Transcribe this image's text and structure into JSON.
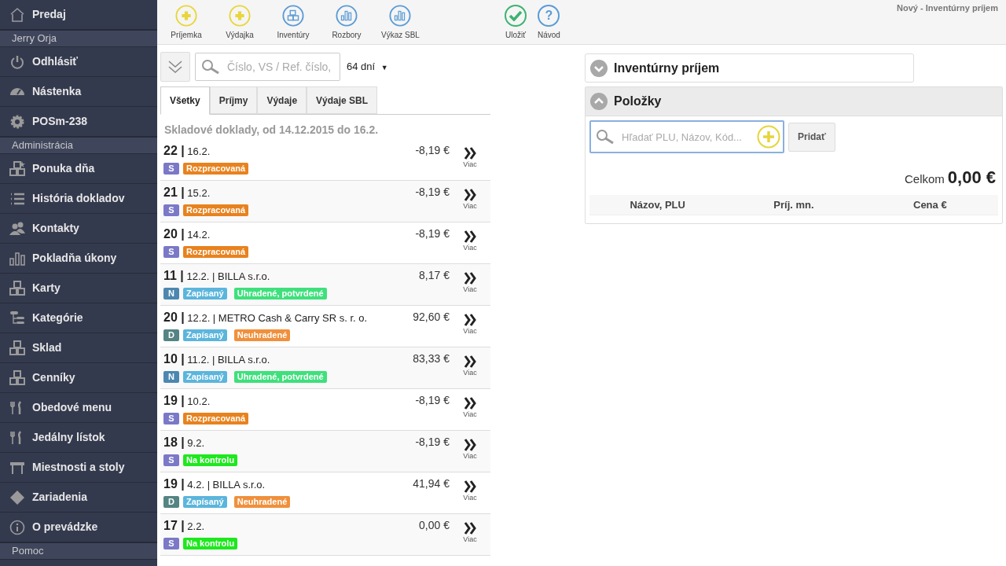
{
  "sidebar": {
    "items": [
      {
        "kind": "item",
        "label": "Predaj"
      },
      {
        "kind": "header",
        "label": "Jerry Orja"
      },
      {
        "kind": "item",
        "label": "Odhlásiť"
      },
      {
        "kind": "item",
        "label": "Nástenka"
      },
      {
        "kind": "item",
        "label": "POSm-238"
      },
      {
        "kind": "header",
        "label": "Administrácia"
      },
      {
        "kind": "item",
        "label": "Ponuka dňa"
      },
      {
        "kind": "item",
        "label": "História dokladov"
      },
      {
        "kind": "item",
        "label": "Kontakty"
      },
      {
        "kind": "item",
        "label": "Pokladňa úkony"
      },
      {
        "kind": "item",
        "label": "Karty"
      },
      {
        "kind": "item",
        "label": "Kategórie"
      },
      {
        "kind": "item",
        "label": "Sklad"
      },
      {
        "kind": "item",
        "label": "Cenníky"
      },
      {
        "kind": "item",
        "label": "Obedové menu"
      },
      {
        "kind": "item",
        "label": "Jedálny lístok"
      },
      {
        "kind": "item",
        "label": "Miestnosti a stoly"
      },
      {
        "kind": "item",
        "label": "Zariadenia"
      },
      {
        "kind": "item",
        "label": "O prevádzke"
      },
      {
        "kind": "header",
        "label": "Pomoc"
      }
    ]
  },
  "toolbar": {
    "buttons": [
      {
        "label": "Príjemka",
        "color": "#e8d63a"
      },
      {
        "label": "Výdajka",
        "color": "#e8d63a"
      },
      {
        "label": "Inventúry",
        "color": "#5b9bd5"
      },
      {
        "label": "Rozbory",
        "color": "#5b9bd5"
      },
      {
        "label": "Výkaz SBL",
        "color": "#5b9bd5"
      }
    ]
  },
  "filter": {
    "placeholder": "Číslo, VS / Ref. číslo,",
    "period": "64 dní",
    "dropdown_arrow": "▼"
  },
  "tabs": [
    {
      "label": "Všetky",
      "selected": true
    },
    {
      "label": "Príjmy",
      "selected": false
    },
    {
      "label": "Výdaje",
      "selected": false
    },
    {
      "label": "Výdaje SBL",
      "selected": false
    }
  ],
  "list_title": "Skladové doklady, od 14.12.2015 do 16.2.",
  "documents": [
    {
      "heading": "**22 |** 16.2.",
      "amount": "-8,19 €",
      "type": {
        "label": "S",
        "color": "#7b78c8"
      },
      "tags": [
        {
          "label": "Rozpracovaná",
          "color": "#e8821e"
        }
      ],
      "more": "Viac"
    },
    {
      "heading": "**21 |** 15.2.",
      "amount": "-8,19 €",
      "type": {
        "label": "S",
        "color": "#7b78c8"
      },
      "tags": [
        {
          "label": "Rozpracovaná",
          "color": "#e8821e"
        }
      ],
      "more": "Viac"
    },
    {
      "heading": "**20 |** 14.2.",
      "amount": "-8,19 €",
      "type": {
        "label": "S",
        "color": "#7b78c8"
      },
      "tags": [
        {
          "label": "Rozpracovaná",
          "color": "#e8821e"
        }
      ],
      "more": "Viac"
    },
    {
      "heading": "**11 |** 12.2. | BILLA s.r.o.",
      "amount": "8,17 €",
      "type": {
        "label": "N",
        "color": "#4b87b0"
      },
      "tags": [
        {
          "label": "Zapísaný",
          "color": "#5bb5dc"
        },
        {
          "label": "Uhradené, potvrdené",
          "color": "#3fe07c"
        }
      ],
      "more": "Viac"
    },
    {
      "heading": "**20 |** 12.2. | METRO Cash & Carry SR s. r. o.",
      "amount": "92,60 €",
      "type": {
        "label": "D",
        "color": "#548483"
      },
      "tags": [
        {
          "label": "Zapísaný",
          "color": "#5bb5dc"
        },
        {
          "label": "Neuhradené",
          "color": "#f0903c"
        }
      ],
      "more": "Viac"
    },
    {
      "heading": "**10 |** 11.2. | BILLA s.r.o.",
      "amount": "83,33 €",
      "type": {
        "label": "N",
        "color": "#4b87b0"
      },
      "tags": [
        {
          "label": "Zapísaný",
          "color": "#5bb5dc"
        },
        {
          "label": "Uhradené, potvrdené",
          "color": "#3fe07c"
        }
      ],
      "more": "Viac"
    },
    {
      "heading": "**19 |** 10.2.",
      "amount": "-8,19 €",
      "type": {
        "label": "S",
        "color": "#7b78c8"
      },
      "tags": [
        {
          "label": "Rozpracovaná",
          "color": "#e8821e"
        }
      ],
      "more": "Viac"
    },
    {
      "heading": "**18 |** 9.2.",
      "amount": "-8,19 €",
      "type": {
        "label": "S",
        "color": "#7b78c8"
      },
      "tags": [
        {
          "label": "Na kontrolu",
          "color": "#1ee81e"
        }
      ],
      "more": "Viac"
    },
    {
      "heading": "**19 |** 4.2. | BILLA s.r.o.",
      "amount": "41,94 €",
      "type": {
        "label": "D",
        "color": "#548483"
      },
      "tags": [
        {
          "label": "Zapísaný",
          "color": "#5bb5dc"
        },
        {
          "label": "Neuhradené",
          "color": "#f0903c"
        }
      ],
      "more": "Viac"
    },
    {
      "heading": "**17 |** 2.2.",
      "amount": "0,00 €",
      "type": {
        "label": "S",
        "color": "#7b78c8"
      },
      "tags": [
        {
          "label": "Na kontrolu",
          "color": "#1ee81e"
        }
      ],
      "more": "Viac"
    }
  ],
  "page_title": "Nový - Inventúrny príjem",
  "actions": [
    {
      "kind": "check",
      "label": "Uložiť",
      "color": "#3cb371"
    },
    {
      "kind": "symbol",
      "symbol": "?",
      "label": "Návod",
      "color": "#5b9bd5"
    }
  ],
  "sections": [
    {
      "title": "Inventúrny príjem",
      "expanded": false
    },
    {
      "title": "Položky",
      "expanded": true
    }
  ],
  "items": {
    "search_placeholder": "Hľadať PLU, Názov, Kód...",
    "add_button": "Pridať",
    "total_label": "Celkom",
    "total": "0,00 €",
    "columns": [
      "Názov, PLU",
      "Príj. mn.",
      "Cena €"
    ]
  }
}
